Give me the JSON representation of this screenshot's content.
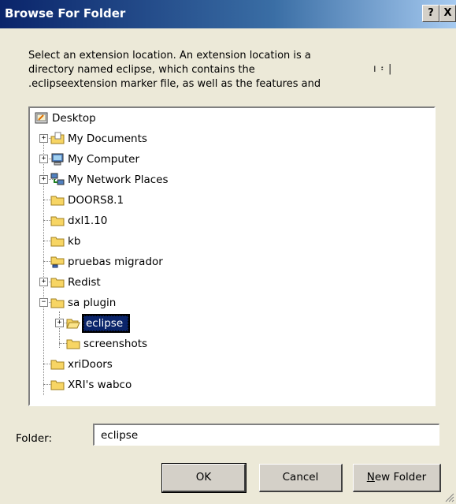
{
  "window": {
    "title": "Browse For Folder",
    "help_label": "?",
    "close_label": "X"
  },
  "description": {
    "line1": "Select an extension location. An extension location is a",
    "line2": "directory named eclipse, which contains the",
    "line3": ".eclipseextension marker file, as well as the features and",
    "artifacts": "ı   ፡   |"
  },
  "tree": {
    "items": [
      {
        "label": "Desktop",
        "icon": "desktop-icon"
      },
      {
        "label": "My Documents",
        "icon": "my-documents-icon"
      },
      {
        "label": "My Computer",
        "icon": "my-computer-icon"
      },
      {
        "label": "My Network Places",
        "icon": "network-places-icon"
      },
      {
        "label": "DOORS8.1",
        "icon": "folder-icon"
      },
      {
        "label": "dxl1.10",
        "icon": "folder-icon"
      },
      {
        "label": "kb",
        "icon": "folder-icon"
      },
      {
        "label": "pruebas migrador",
        "icon": "shared-folder-icon"
      },
      {
        "label": "Redist",
        "icon": "folder-icon"
      },
      {
        "label": "sa plugin",
        "icon": "folder-icon"
      },
      {
        "label": "eclipse",
        "icon": "open-folder-icon"
      },
      {
        "label": "screenshots",
        "icon": "folder-icon"
      },
      {
        "label": "xriDoors",
        "icon": "folder-icon"
      },
      {
        "label": "XRI's wabco",
        "icon": "folder-icon"
      }
    ],
    "selected": "eclipse"
  },
  "folder_field": {
    "label": "Folder:",
    "value": "eclipse"
  },
  "buttons": {
    "ok": "OK",
    "cancel": "Cancel",
    "new_folder_first": "N",
    "new_folder_rest": "ew Folder"
  },
  "colors": {
    "title_bar": "#0a246a",
    "dialog_bg": "#ece9d8",
    "selection": "#0a246a",
    "folder_yellow": "#f7d564"
  }
}
